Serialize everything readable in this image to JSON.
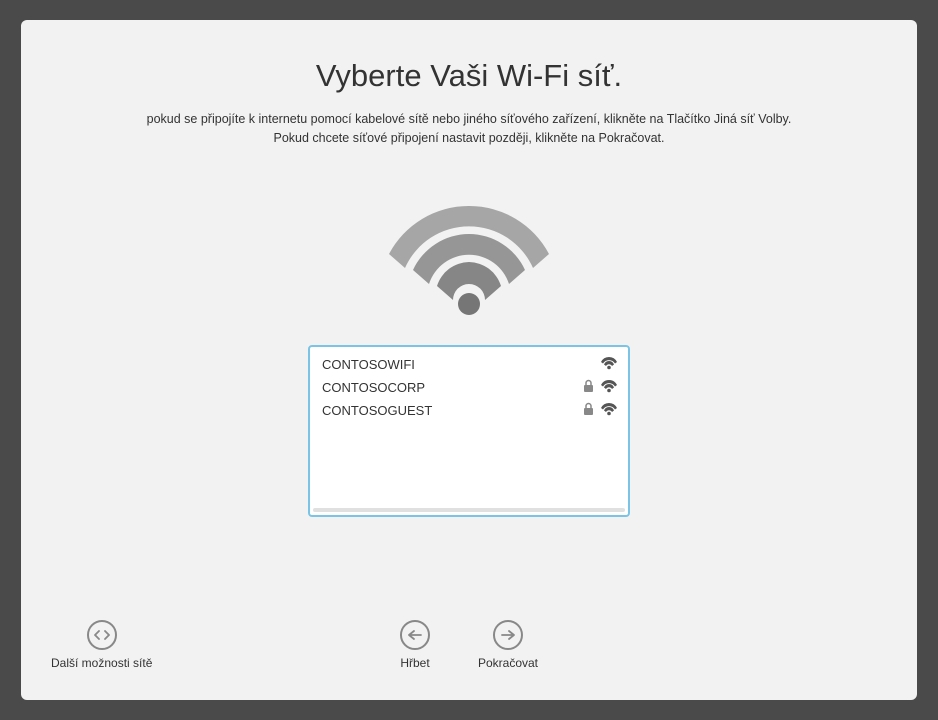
{
  "title": "Vyberte Vaši Wi-Fi síť.",
  "subtitle": "pokud se připojíte k internetu pomocí kabelové sítě nebo jiného síťového zařízení, klikněte na Tlačítko Jiná síť Volby. Pokud chcete síťové připojení nastavit později, klikněte na Pokračovat.",
  "networks": [
    {
      "name": "CONTOSOWIFI",
      "locked": false,
      "signal": true
    },
    {
      "name": "CONTOSOCORP",
      "locked": true,
      "signal": true
    },
    {
      "name": "CONTOSOGUEST",
      "locked": true,
      "signal": true
    }
  ],
  "buttons": {
    "other_options": "Další možnosti sítě",
    "back": "Hřbet",
    "continue": "Pokračovat"
  }
}
